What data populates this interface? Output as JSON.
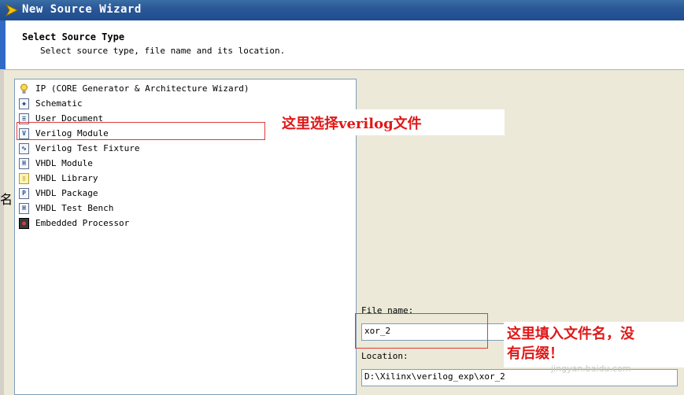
{
  "window": {
    "title": "New Source Wizard"
  },
  "header": {
    "title": "Select Source Type",
    "subtitle": "Select source type, file name and its location."
  },
  "edge_glyph": "名",
  "source_types": [
    {
      "label": "IP (CORE Generator & Architecture Wizard)",
      "icon": "ip-bulb-icon"
    },
    {
      "label": "Schematic",
      "icon": "schematic-icon"
    },
    {
      "label": "User Document",
      "icon": "document-icon"
    },
    {
      "label": "Verilog Module",
      "icon": "verilog-module-icon"
    },
    {
      "label": "Verilog Test Fixture",
      "icon": "verilog-test-fixture-icon"
    },
    {
      "label": "VHDL Module",
      "icon": "vhdl-module-icon"
    },
    {
      "label": "VHDL Library",
      "icon": "vhdl-library-icon"
    },
    {
      "label": "VHDL Package",
      "icon": "vhdl-package-icon"
    },
    {
      "label": "VHDL Test Bench",
      "icon": "vhdl-test-bench-icon"
    },
    {
      "label": "Embedded Processor",
      "icon": "embedded-processor-icon"
    }
  ],
  "selected_index": 3,
  "form": {
    "file_name_label": "File name:",
    "file_name_value": "xor_2",
    "location_label": "Location:",
    "location_value": "D:\\Xilinx\\verilog_exp\\xor_2"
  },
  "annotations": {
    "select_note": "这里选择verilog文件",
    "name_note_line1": "这里填入文件名，没",
    "name_note_line2": "有后缀！"
  },
  "watermark": "jingyan.baidu.com",
  "colors": {
    "titlebar": "#2b5797",
    "annotation_red": "#e01818",
    "input_border": "#7f9db9",
    "dialog_bg": "#ece9d8"
  }
}
